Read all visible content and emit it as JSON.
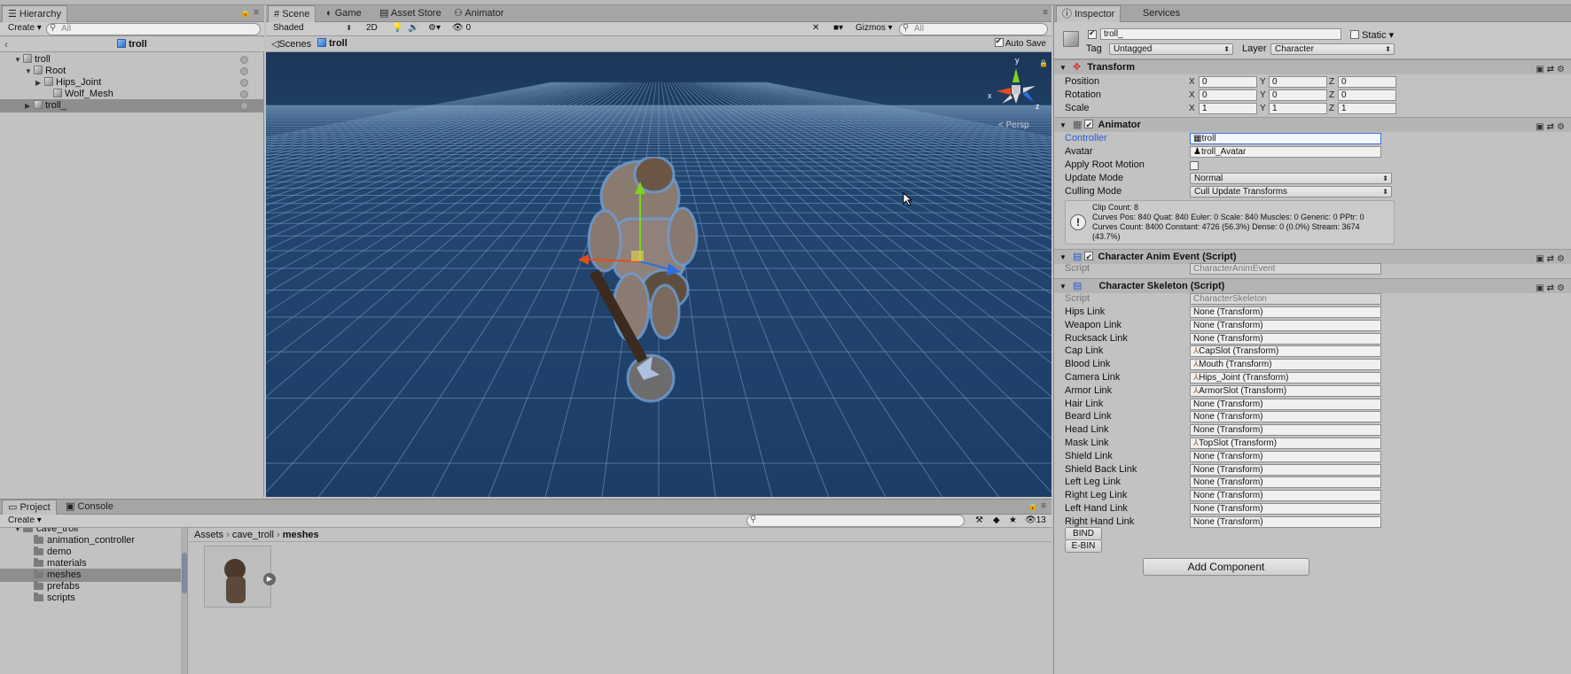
{
  "hierarchy": {
    "tab": "Hierarchy",
    "create": "Create",
    "search_placeholder": "All",
    "scene_name": "troll",
    "items": [
      {
        "label": "troll"
      },
      {
        "label": "Root"
      },
      {
        "label": "Hips_Joint"
      },
      {
        "label": "Wolf_Mesh"
      },
      {
        "label": "troll_"
      }
    ]
  },
  "scene_view": {
    "tabs": [
      "Scene",
      "Game",
      "Asset Store",
      "Animator"
    ],
    "shading": "Shaded",
    "mode_2d": "2D",
    "layers_count": "0",
    "gizmos": "Gizmos",
    "search_placeholder": "All",
    "breadcrumb_scenes": "Scenes",
    "breadcrumb_current": "troll",
    "auto_save": "Auto Save",
    "persp": "Persp",
    "axis_x": "x",
    "axis_y": "y",
    "axis_z": "z"
  },
  "project": {
    "tabs": [
      "Project",
      "Console"
    ],
    "create": "Create",
    "folders": [
      {
        "label": "cave_troll"
      },
      {
        "label": "animation_controller"
      },
      {
        "label": "demo"
      },
      {
        "label": "materials"
      },
      {
        "label": "meshes"
      },
      {
        "label": "prefabs"
      },
      {
        "label": "scripts"
      }
    ],
    "breadcrumb": [
      "Assets",
      "cave_troll",
      "meshes"
    ],
    "count": "13"
  },
  "inspector": {
    "tabs": [
      "Inspector",
      "Services"
    ],
    "object_name": "troll_",
    "static_label": "Static",
    "tag_label": "Tag",
    "tag_value": "Untagged",
    "layer_label": "Layer",
    "layer_value": "Character",
    "transform": {
      "title": "Transform",
      "rows": [
        {
          "label": "Position",
          "x": "0",
          "y": "0",
          "z": "0"
        },
        {
          "label": "Rotation",
          "x": "0",
          "y": "0",
          "z": "0"
        },
        {
          "label": "Scale",
          "x": "1",
          "y": "1",
          "z": "1"
        }
      ]
    },
    "animator": {
      "title": "Animator",
      "controller_label": "Controller",
      "controller_value": "troll",
      "avatar_label": "Avatar",
      "avatar_value": "troll_Avatar",
      "root_motion_label": "Apply Root Motion",
      "update_label": "Update Mode",
      "update_value": "Normal",
      "culling_label": "Culling Mode",
      "culling_value": "Cull Update Transforms",
      "info_lines": [
        "Clip Count: 8",
        "Curves Pos: 840 Quat: 840 Euler: 0 Scale: 840 Muscles: 0 Generic: 0 PPtr: 0",
        "Curves Count: 8400 Constant: 4726 (56.3%) Dense: 0 (0.0%) Stream: 3674",
        "(43.7%)"
      ]
    },
    "anim_event": {
      "title": "Character Anim Event (Script)",
      "script_label": "Script",
      "script_value": "CharacterAnimEvent"
    },
    "skeleton": {
      "title": "Character Skeleton (Script)",
      "script_label": "Script",
      "script_value": "CharacterSkeleton",
      "links": [
        {
          "label": "Hips Link",
          "value": "None (Transform)"
        },
        {
          "label": "Weapon Link",
          "value": "None (Transform)"
        },
        {
          "label": "Rucksack Link",
          "value": "None (Transform)"
        },
        {
          "label": "Cap Link",
          "value": "CapSlot (Transform)"
        },
        {
          "label": "Blood Link",
          "value": "Mouth (Transform)"
        },
        {
          "label": "Camera Link",
          "value": "Hips_Joint (Transform)"
        },
        {
          "label": "Armor Link",
          "value": "ArmorSlot (Transform)"
        },
        {
          "label": "Hair Link",
          "value": "None (Transform)"
        },
        {
          "label": "Beard Link",
          "value": "None (Transform)"
        },
        {
          "label": "Head Link",
          "value": "None (Transform)"
        },
        {
          "label": "Mask Link",
          "value": "TopSlot (Transform)"
        },
        {
          "label": "Shield Link",
          "value": "None (Transform)"
        },
        {
          "label": "Shield Back Link",
          "value": "None (Transform)"
        },
        {
          "label": "Left Leg Link",
          "value": "None (Transform)"
        },
        {
          "label": "Right Leg Link",
          "value": "None (Transform)"
        },
        {
          "label": "Left Hand Link",
          "value": "None (Transform)"
        },
        {
          "label": "Right Hand Link",
          "value": "None (Transform)"
        }
      ],
      "bind_label": "BIND",
      "rebind_label": "E-BIN"
    },
    "add_component": "Add Component"
  },
  "colors": {
    "scene_sky": "#1f4068",
    "selection": "#8e8e8e",
    "controller_highlight": "#3a6fd8"
  }
}
